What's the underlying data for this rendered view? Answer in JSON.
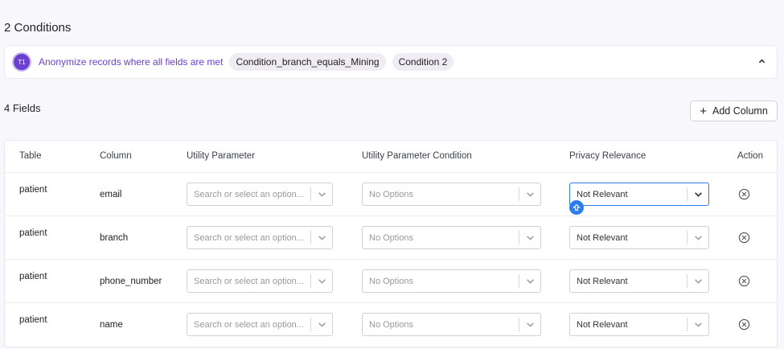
{
  "conditions": {
    "title": "2 Conditions",
    "avatar_text": "T1",
    "description": "Anonymize records where all fields are met",
    "chips": [
      "Condition_branch_equals_Mining",
      "Condition 2"
    ]
  },
  "fields": {
    "title": "4 Fields",
    "add_column_label": "Add Column"
  },
  "table": {
    "headers": {
      "table": "Table",
      "column": "Column",
      "utility_parameter": "Utility Parameter",
      "utility_parameter_condition": "Utility Parameter Condition",
      "privacy_relevance": "Privacy Relevance",
      "action": "Action"
    },
    "rows": [
      {
        "table": "patient",
        "column": "email",
        "utility_placeholder": "Search or select an option...",
        "condition_value": "No Options",
        "privacy_value": "Not Relevant"
      },
      {
        "table": "patient",
        "column": "branch",
        "utility_placeholder": "Search or select an option...",
        "condition_value": "No Options",
        "privacy_value": "Not Relevant"
      },
      {
        "table": "patient",
        "column": "phone_number",
        "utility_placeholder": "Search or select an option...",
        "condition_value": "No Options",
        "privacy_value": "Not Relevant"
      },
      {
        "table": "patient",
        "column": "name",
        "utility_placeholder": "Search or select an option...",
        "condition_value": "No Options",
        "privacy_value": "Not Relevant"
      }
    ]
  },
  "colors": {
    "accent": "#6b3fd0",
    "focus": "#2b7de9"
  }
}
